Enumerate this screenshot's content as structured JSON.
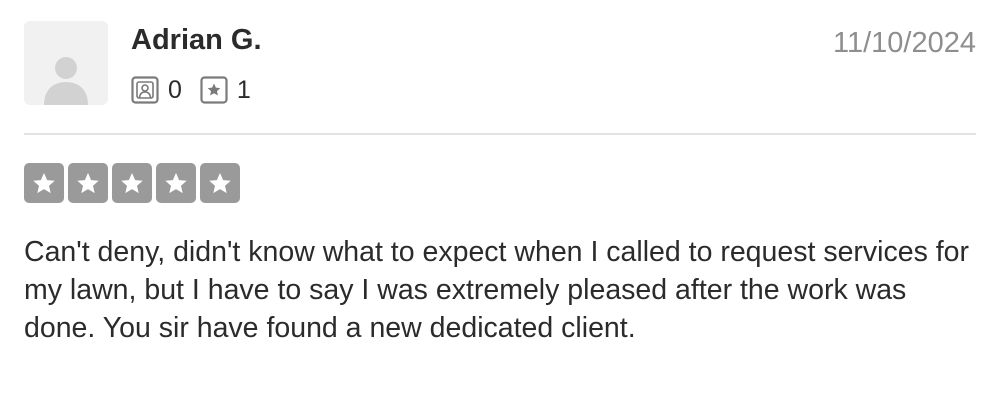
{
  "review": {
    "reviewer": {
      "name": "Adrian G.",
      "avatar_icon": "default-user-avatar"
    },
    "date": "11/10/2024",
    "stats": {
      "reviews_icon": "user-reviews-icon",
      "reviews_count": "0",
      "photos_icon": "star-badge-icon",
      "photos_count": "1"
    },
    "rating": {
      "stars": 5,
      "max": 5,
      "star_box_color": "#9a9a9a"
    },
    "text": "Can't deny, didn't know what to expect when I called to request services for my lawn, but I have to say I was extremely pleased after the work was done. You sir have found a new dedicated client."
  }
}
